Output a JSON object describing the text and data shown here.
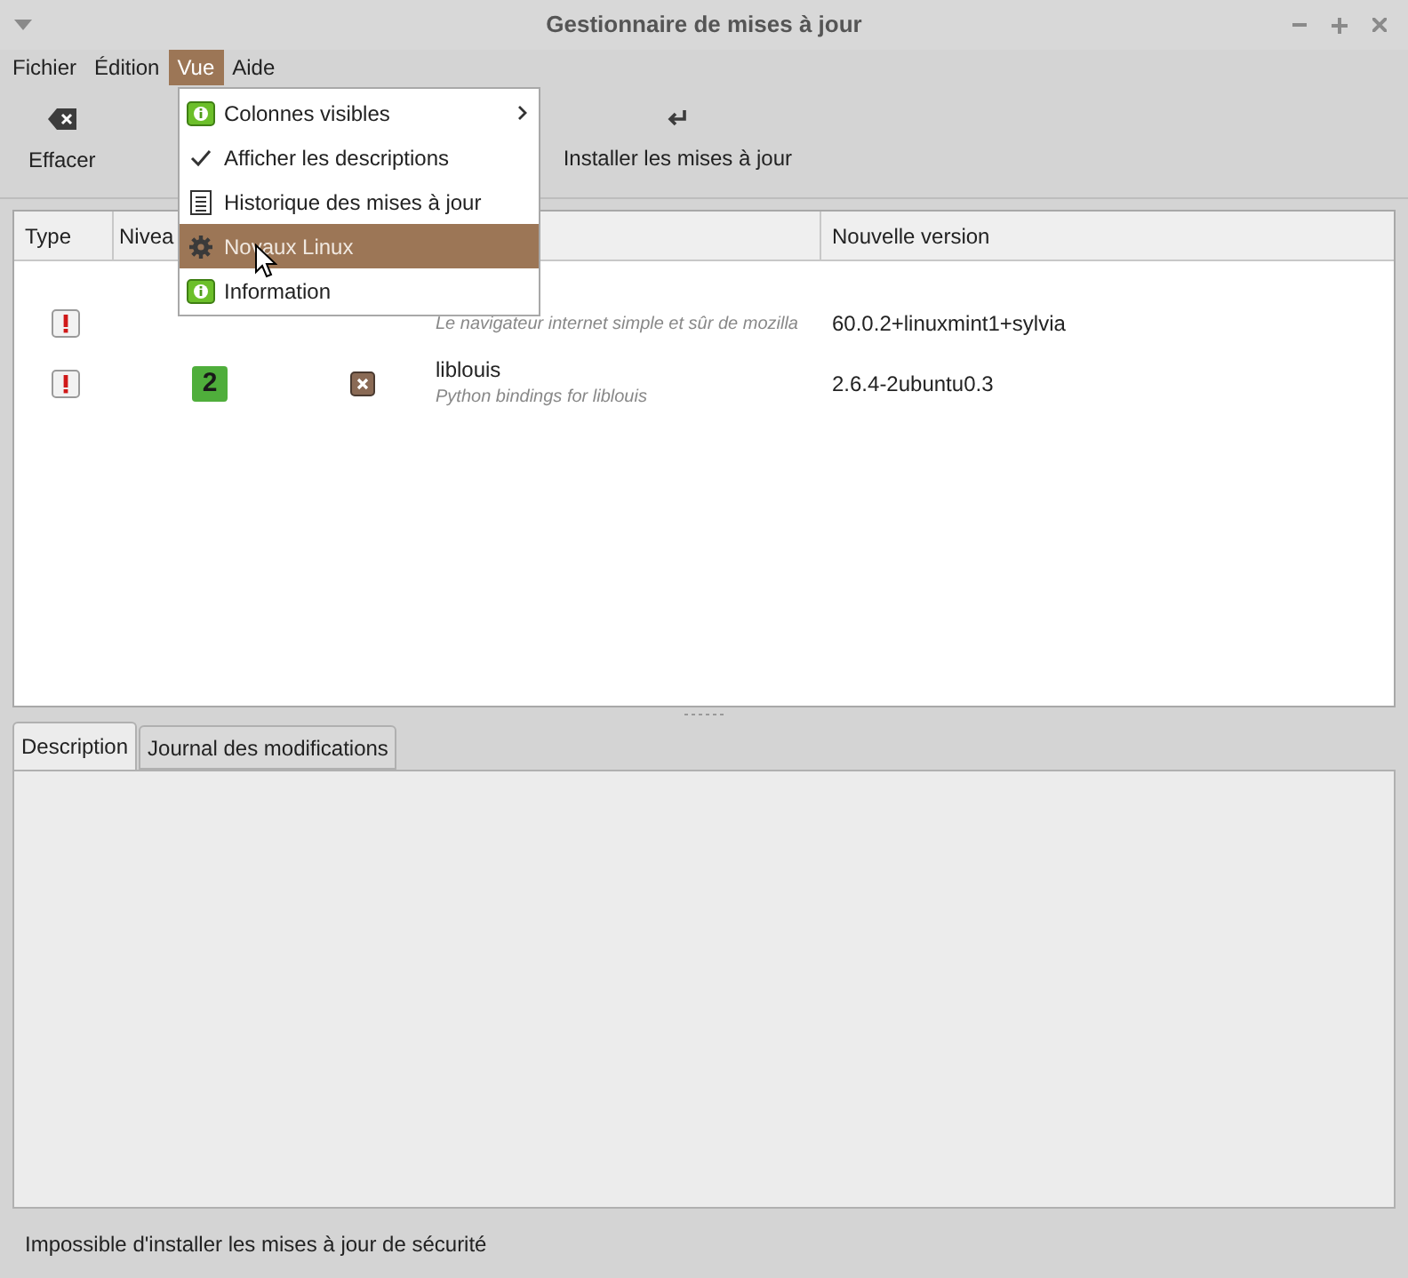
{
  "window": {
    "title": "Gestionnaire de mises à jour"
  },
  "menubar": [
    {
      "label": "Fichier",
      "selected": false
    },
    {
      "label": "Édition",
      "selected": false
    },
    {
      "label": "Vue",
      "selected": true
    },
    {
      "label": "Aide",
      "selected": false
    }
  ],
  "toolbar": [
    {
      "label": "Effacer"
    },
    {
      "label": "Installer les mises à jour"
    }
  ],
  "table": {
    "header": {
      "type": "Type",
      "level": "Nivea",
      "version": "Nouvelle version"
    },
    "rows": [
      {
        "description": "Le navigateur internet simple et sûr de mozilla",
        "version": "60.0.2+linuxmint1+sylvia"
      },
      {
        "level": "2",
        "color": "#4fae3b",
        "name": "liblouis",
        "description": "Python bindings for liblouis",
        "version": "2.6.4-2ubuntu0.3"
      }
    ]
  },
  "menu": [
    {
      "kind": "submenu",
      "label": "Colonnes visibles",
      "selected": false
    },
    {
      "kind": "check",
      "checked": true,
      "label": "Afficher les descriptions",
      "selected": false
    },
    {
      "kind": "history",
      "label": "Historique des mises à jour",
      "selected": false
    },
    {
      "kind": "kernel",
      "label": "Novaux Linux",
      "selected": true
    },
    {
      "kind": "info",
      "label": "Information",
      "selected": false
    }
  ],
  "tabs": [
    {
      "label": "Description",
      "selected": true
    },
    {
      "label": "Journal des modifications",
      "selected": false
    }
  ],
  "status_bar": "Impossible d'installer les mises à jour de sécurité"
}
